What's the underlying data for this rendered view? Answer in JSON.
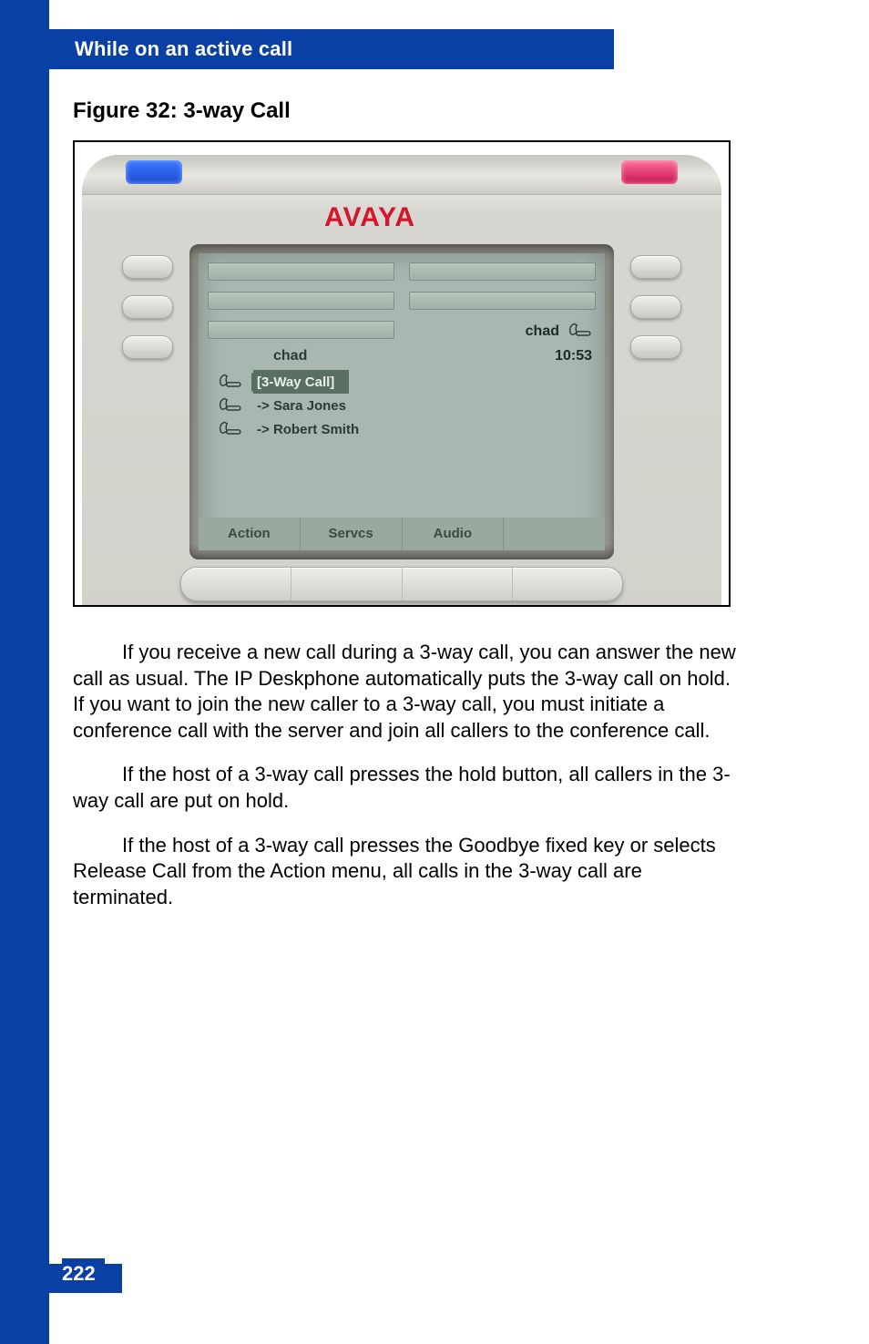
{
  "header": {
    "section_title": "While on an active call"
  },
  "figure": {
    "caption": "Figure 32: 3-way Call"
  },
  "phone": {
    "brand": "AVAYA",
    "status_user": "chad",
    "screen_user": "chad",
    "time": "10:53",
    "selected_label": "[3-Way Call]",
    "participants": [
      {
        "prefix": "->",
        "name": "Sara Jones"
      },
      {
        "prefix": "->",
        "name": "Robert Smith"
      }
    ],
    "softkeys": {
      "k1": "Action",
      "k2": "Servcs",
      "k3": "Audio",
      "k4": ""
    }
  },
  "paragraphs": {
    "p1": "If you receive a new call during a 3-way call, you can answer the new call as usual. The IP Deskphone automatically puts the 3-way call on hold. If you want to join the new caller to a 3-way call, you must initiate a conference call with the server and join all callers to the conference call.",
    "p2": "If the host of a 3-way call presses the hold button, all callers in the 3-way call are put on hold.",
    "p3": "If the host of a 3-way call presses the Goodbye fixed key or selects Release Call from the Action menu, all calls in the 3-way call are terminated."
  },
  "page_number": "222"
}
